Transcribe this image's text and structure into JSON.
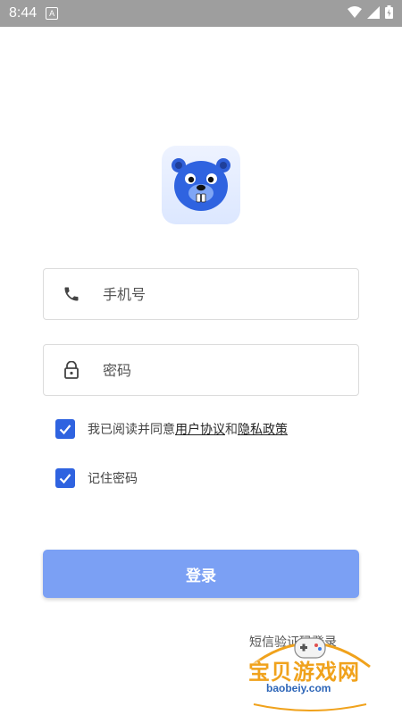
{
  "status_bar": {
    "time": "8:44",
    "notification_letter": "A"
  },
  "app": {
    "logo_icon": "beaver-mascot-icon"
  },
  "form": {
    "phone_placeholder": "手机号",
    "password_placeholder": "密码",
    "agree_prefix": "我已阅读并同意",
    "user_agreement": "用户协议",
    "and_text": "和",
    "privacy_policy": "隐私政策",
    "remember_password": "记住密码",
    "agree_checked": true,
    "remember_checked": true
  },
  "actions": {
    "login_label": "登录",
    "sms_login_label": "短信验证码登录"
  },
  "watermark": {
    "text": "宝贝游戏网",
    "url": "baobeiy.com"
  },
  "colors": {
    "accent": "#2f63e0",
    "button": "#7ba0f4",
    "status_bar": "#9e9e9e"
  }
}
